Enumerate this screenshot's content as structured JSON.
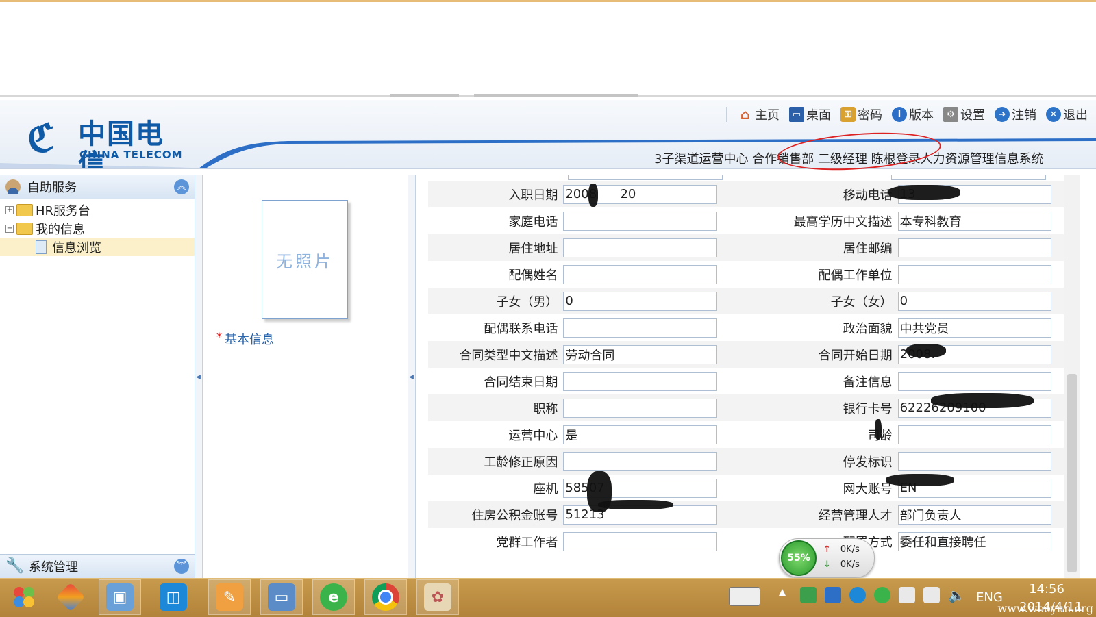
{
  "header": {
    "logo_cn": "中国电信",
    "logo_en": "CHINA TELECOM",
    "nav": [
      {
        "label": "主页",
        "icon": "home-icon"
      },
      {
        "label": "桌面",
        "icon": "desktop-icon"
      },
      {
        "label": "密码",
        "icon": "lock-icon"
      },
      {
        "label": "版本",
        "icon": "info-icon"
      },
      {
        "label": "设置",
        "icon": "settings-icon"
      },
      {
        "label": "注销",
        "icon": "logout-icon"
      },
      {
        "label": "退出",
        "icon": "exit-icon"
      }
    ],
    "subtitle": "3子渠道运营中心 合作销售部 二级经理 陈根登录人力资源管理信息系统"
  },
  "sidebar": {
    "title": "自助服务",
    "items": [
      {
        "label": "HR服务台",
        "toggle": "+"
      },
      {
        "label": "我的信息",
        "toggle": "−"
      },
      {
        "label": "信息浏览"
      }
    ],
    "footer": "系统管理"
  },
  "photo_panel": {
    "photo_text": "无照片",
    "section_label": "基本信息",
    "required_mark": "*"
  },
  "form": {
    "rows": [
      {
        "l1": "入职日期",
        "v1": "2008",
        "v1b": "20",
        "l2": "移动电话",
        "v2": "13"
      },
      {
        "l1": "家庭电话",
        "v1": "",
        "l2": "最高学历中文描述",
        "v2": "本专科教育"
      },
      {
        "l1": "居住地址",
        "v1": "",
        "l2": "居住邮编",
        "v2": ""
      },
      {
        "l1": "配偶姓名",
        "v1": "",
        "l2": "配偶工作单位",
        "v2": ""
      },
      {
        "l1": "子女（男）",
        "v1": "0",
        "l2": "子女（女）",
        "v2": "0"
      },
      {
        "l1": "配偶联系电话",
        "v1": "",
        "l2": "政治面貌",
        "v2": "中共党员"
      },
      {
        "l1": "合同类型中文描述",
        "v1": "劳动合同",
        "l2": "合同开始日期",
        "v2": "2008."
      },
      {
        "l1": "合同结束日期",
        "v1": "",
        "l2": "备注信息",
        "v2": ""
      },
      {
        "l1": "职称",
        "v1": "",
        "l2": "银行卡号",
        "v2": "62226209100"
      },
      {
        "l1": "运营中心",
        "v1": "是",
        "l2": "司龄",
        "v2": ""
      },
      {
        "l1": "工龄修正原因",
        "v1": "",
        "l2": "停发标识",
        "v2": ""
      },
      {
        "l1": "座机",
        "v1": "58507",
        "l2": "网大账号",
        "v2": "EN"
      },
      {
        "l1": "住房公积金账号",
        "v1": "51213",
        "l2": "经营管理人才",
        "v2": "部门负责人"
      },
      {
        "l1": "党群工作者",
        "v1": "",
        "l2": "配置方式",
        "v2": "委任和直接聘任"
      }
    ]
  },
  "net_widget": {
    "percent": "55%",
    "up": "0K/s",
    "down": "0K/s"
  },
  "taskbar": {
    "lang": "ENG",
    "time": "14:56",
    "date": "2014/4/11",
    "watermark": "www.wooyun.org"
  },
  "colors": {
    "brand": "#0f5aa6",
    "link": "#1f5ea8",
    "taskbar": "#c79a4d",
    "annotation": "#dd2222"
  }
}
